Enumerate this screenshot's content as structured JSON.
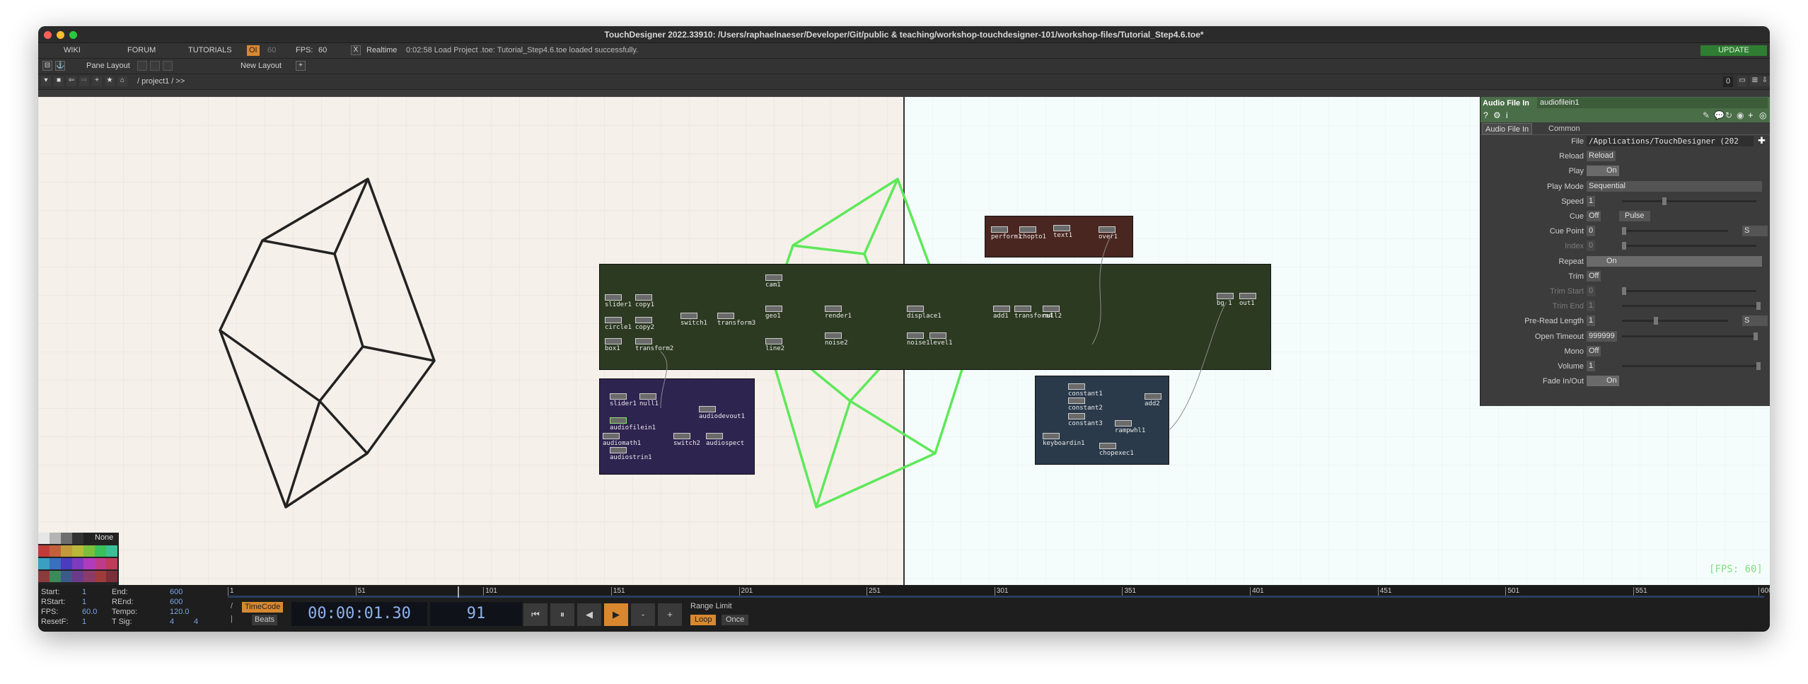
{
  "window": {
    "title": "TouchDesigner 2022.33910: /Users/raphaelnaeser/Developer/Git/public & teaching/workshop-touchdesigner-101/workshop-files/Tutorial_Step4.6.toe*"
  },
  "menubar": {
    "wiki": "WIKI",
    "forum": "FORUM",
    "tutorials": "TUTORIALS",
    "oi_badge": "OI",
    "fps_dim": "60",
    "fps_label": "FPS:",
    "fps_value": "60",
    "realtime_x": "X",
    "realtime": "Realtime",
    "status": "0:02:58 Load Project .toe: Tutorial_Step4.6.toe loaded successfully.",
    "update": "UPDATE"
  },
  "panebar": {
    "pane_layout": "Pane Layout",
    "new_layout": "New Layout",
    "plus": "+"
  },
  "pathbar": {
    "path": "/ project1 / >>",
    "counter": "0"
  },
  "network": {
    "fps_overlay": "[FPS: 60]",
    "palette_none": "None",
    "top_brown_ops": [
      "perform1",
      "chopto1",
      "text1",
      "over1"
    ],
    "green_ops": [
      "slider1",
      "copy1",
      "circle1",
      "copy2",
      "box1",
      "transform2",
      "switch1",
      "transform3",
      "cam1",
      "geo1",
      "line2",
      "render1",
      "noise2",
      "displace1",
      "noise1",
      "level1",
      "add1",
      "transform4",
      "null2",
      "bg 1",
      "out1"
    ],
    "purple_ops": [
      "slider1",
      "null1",
      "audiodevout1",
      "audiofilein1",
      "audiomath1",
      "switch2",
      "audiospect",
      "audiostrin1"
    ],
    "blue_ops": [
      "constant1",
      "constant2",
      "constant3",
      "add2",
      "rampwhl1",
      "keyboardin1",
      "chopexec1"
    ]
  },
  "params": {
    "op_type": "Audio File In",
    "op_name": "audiofilein1",
    "tabs": [
      "Audio File In",
      "Common"
    ],
    "rows": [
      {
        "label": "File",
        "value": "/Applications/TouchDesigner (202",
        "dim": false
      },
      {
        "label": "Reload",
        "value": "Reload",
        "dim": false
      },
      {
        "label": "Play",
        "value": "On",
        "dim": false
      },
      {
        "label": "Play Mode",
        "value": "Sequential",
        "dim": false
      },
      {
        "label": "Speed",
        "value": "1",
        "dim": false
      },
      {
        "label": "Cue",
        "value": "Off",
        "extra": "Pulse",
        "dim": false
      },
      {
        "label": "Cue Point",
        "value": "0",
        "unit": "S",
        "dim": false
      },
      {
        "label": "Index",
        "value": "0",
        "dim": true
      },
      {
        "label": "Repeat",
        "value": "On",
        "dim": false
      },
      {
        "label": "Trim",
        "value": "Off",
        "dim": false
      },
      {
        "label": "Trim Start",
        "value": "0",
        "dim": true
      },
      {
        "label": "Trim End",
        "value": "1",
        "dim": true
      },
      {
        "label": "Pre-Read Length",
        "value": "1",
        "unit": "S",
        "dim": false
      },
      {
        "label": "Open Timeout",
        "value": "999999",
        "dim": false
      },
      {
        "label": "Mono",
        "value": "Off",
        "dim": false
      },
      {
        "label": "Volume",
        "value": "1",
        "dim": false
      },
      {
        "label": "Fade In/Out",
        "value": "On",
        "dim": false
      }
    ]
  },
  "timeline": {
    "start_label": "Start:",
    "start": "1",
    "end_label": "End:",
    "end": "600",
    "rstart_label": "RStart:",
    "rstart": "1",
    "rend_label": "REnd:",
    "rend": "600",
    "fps_label": "FPS:",
    "fps": "60.0",
    "tempo_label": "Tempo:",
    "tempo": "120.0",
    "resetf_label": "ResetF:",
    "resetf": "1",
    "tsig_label": "T Sig:",
    "tsig_a": "4",
    "tsig_b": "4",
    "timecode": "TimeCode",
    "beats": "Beats",
    "time": "00:00:01.30",
    "frame": "91",
    "range_limit": "Range Limit",
    "loop": "Loop",
    "once": "Once",
    "ruler": [
      "1",
      "51",
      "101",
      "151",
      "201",
      "251",
      "301",
      "351",
      "401",
      "451",
      "501",
      "551",
      "600"
    ]
  },
  "colors": {
    "accent_orange": "#d9882f",
    "update_green": "#2f7d32",
    "brown_box": "#4a2620",
    "green_box": "#2c3a22",
    "purple_box": "#2e2450",
    "blue_box": "#2a3a4a",
    "wireframe_green": "#5ee85a"
  }
}
